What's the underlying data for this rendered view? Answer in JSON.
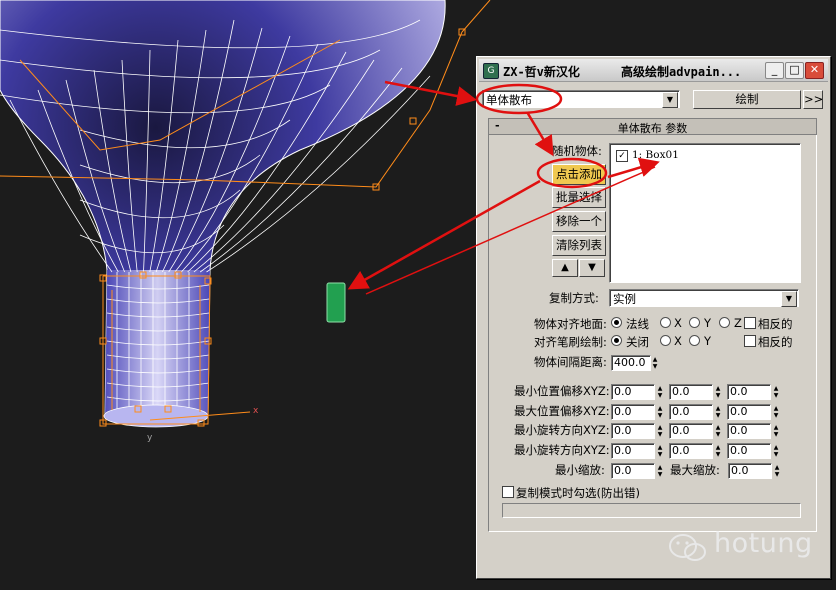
{
  "window": {
    "title": "ZX-哲v新汉化",
    "subtitle": "高级绘制advpain...",
    "min_glyph": "_",
    "max_glyph": "□",
    "close_glyph": "✕"
  },
  "top": {
    "mode_select": "单体散布",
    "paint_button": "绘制",
    "more_button": ">>"
  },
  "rollout": {
    "collapse": "-",
    "title": "单体散布 参数",
    "random_objects_label": "随机物体:",
    "buttons": {
      "click_add": "点击添加",
      "batch_select": "批量选择",
      "remove_one": "移除一个",
      "clear_list": "清除列表",
      "up": "▲",
      "down": "▼"
    },
    "list_items": [
      {
        "checked": true,
        "label": "1:  Box01"
      }
    ],
    "copy_mode_label": "复制方式:",
    "copy_mode_value": "实例",
    "align_surface_label": "物体对齐地面:",
    "align_surface_options": [
      "法线",
      "X",
      "Y",
      "Z"
    ],
    "relative_label": "相反的",
    "align_brush_label": "对齐笔刷绘制:",
    "align_brush_options": [
      "关闭",
      "X",
      "Y"
    ],
    "relative_label_2": "相反的",
    "spacing_label": "物体间隔距离:",
    "spacing_value": "400.0",
    "offset_rows": [
      {
        "label": "最小位置偏移XYZ:",
        "values": [
          "0.0",
          "0.0",
          "0.0"
        ]
      },
      {
        "label": "最大位置偏移XYZ:",
        "values": [
          "0.0",
          "0.0",
          "0.0"
        ]
      },
      {
        "label": "最小旋转方向XYZ:",
        "values": [
          "0.0",
          "0.0",
          "0.0"
        ]
      },
      {
        "label": "最小旋转方向XYZ:",
        "values": [
          "0.0",
          "0.0",
          "0.0"
        ]
      }
    ],
    "min_scale_label": "最小缩放:",
    "min_scale_value": "0.0",
    "max_scale_label": "最大缩放:",
    "max_scale_value": "0.0",
    "copy_check_label": "复制模式时勾选(防出错)"
  },
  "viewport": {
    "axis_label": "x",
    "axis_label_y": "y"
  },
  "watermark": {
    "text": "hotung"
  },
  "colors": {
    "annotation_red": "#e01010",
    "mesh_fill": "#5a55c8",
    "selection_orange": "#ff8c1a",
    "green_object": "#22a050"
  }
}
